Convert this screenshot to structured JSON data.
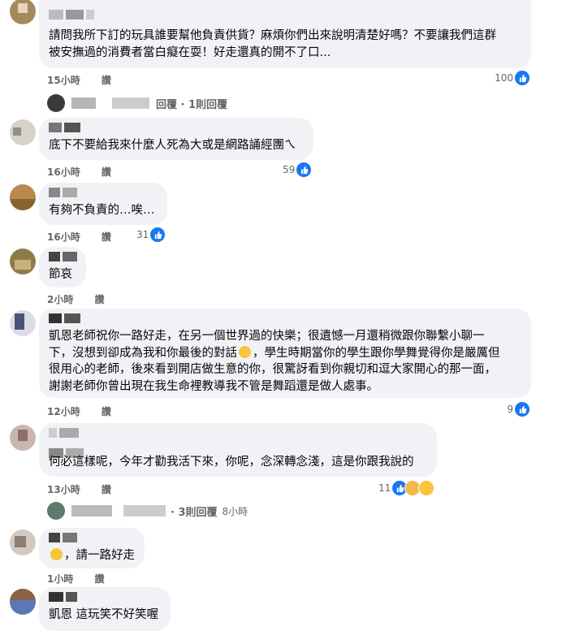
{
  "comments": [
    {
      "text": "請問我所下訂的玩具誰要幫他負責供貨？麻煩你們出來說明清楚好嗎？不要讓我們這群\n被安撫過的消費者當白癡在耍！好走還真的開不了口...",
      "time": "15小時",
      "like": "讚",
      "reactions": "100"
    },
    {
      "text": "底下不要給我來什麼人死為大或是網路誦經團ㄟ",
      "time": "16小時",
      "like": "讚",
      "reactions": "59"
    },
    {
      "text": "有夠不負責的…唉…",
      "time": "16小時",
      "like": "讚",
      "reactions": "31"
    },
    {
      "text": "節哀",
      "time": "2小時",
      "like": "讚",
      "reactions": ""
    },
    {
      "text_a": "凱恩老師祝你一路好走，在另一個世界過的快樂；很遺憾一月還稍微跟你聯繫小聊一\n下，沒想到卻成為我和你最後的對話",
      "text_b": "，學生時期當你的學生跟你學舞覺得你是嚴厲但\n很用心的老師，後來看到開店做生意的你，很驚訝看到你親切和逗大家開心的那一面，\n謝謝老師你曾出現在我生命裡教導我不管是舞蹈還是做人處事。",
      "time": "12小時",
      "like": "讚",
      "reactions": "9"
    },
    {
      "text": "何必這樣呢，今年才勸我活下來，你呢，念深轉念淺，這是你跟我說的",
      "time": "13小時",
      "like": "讚",
      "reactions": "11"
    },
    {
      "text": "，請一路好走",
      "time": "1小時",
      "like": "讚",
      "reactions": ""
    },
    {
      "text": "凱恩 這玩笑不好笑喔",
      "time": "",
      "like": "",
      "reactions": ""
    }
  ],
  "replies": [
    {
      "label": "回覆 · 1則回覆",
      "time": ""
    },
    {
      "label": "· 3則回覆",
      "time": "8小時"
    }
  ],
  "colors": {
    "bubble": "#f0f2f5",
    "meta": "#65676b",
    "like": "#1877f2"
  },
  "icons": [
    "like-icon",
    "care-emoji-icon",
    "sad-emoji-icon",
    "pensive-emoji-icon"
  ]
}
